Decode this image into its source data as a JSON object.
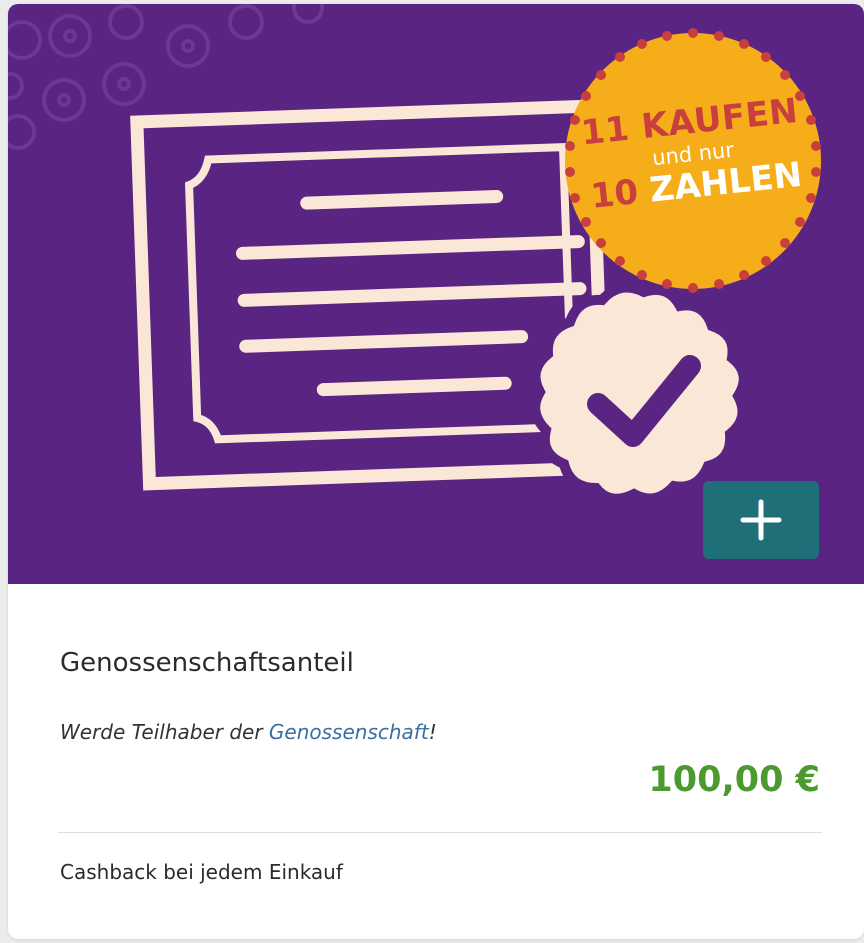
{
  "product": {
    "promo": {
      "line1_number": "11",
      "line1_word": "KAUFEN",
      "line2": "und nur",
      "line3_number": "10",
      "line3_word": "ZAHLEN"
    },
    "title": "Genossenschaftsanteil",
    "subtitle_prefix": "Werde Teilhaber der ",
    "subtitle_link": "Genossenschaft",
    "subtitle_suffix": "!",
    "price": "100,00 €",
    "cashback": "Cashback bei jedem Einkauf"
  },
  "colors": {
    "hero_background": "#5a2482",
    "promo_badge": "#f6ad1a",
    "promo_accent": "#c83f3d",
    "add_button": "#1e6f78",
    "price": "#4a9a2f",
    "link": "#3a6ea5"
  },
  "icons": {
    "add_button": "plus-icon",
    "seal": "checkmark-icon"
  }
}
